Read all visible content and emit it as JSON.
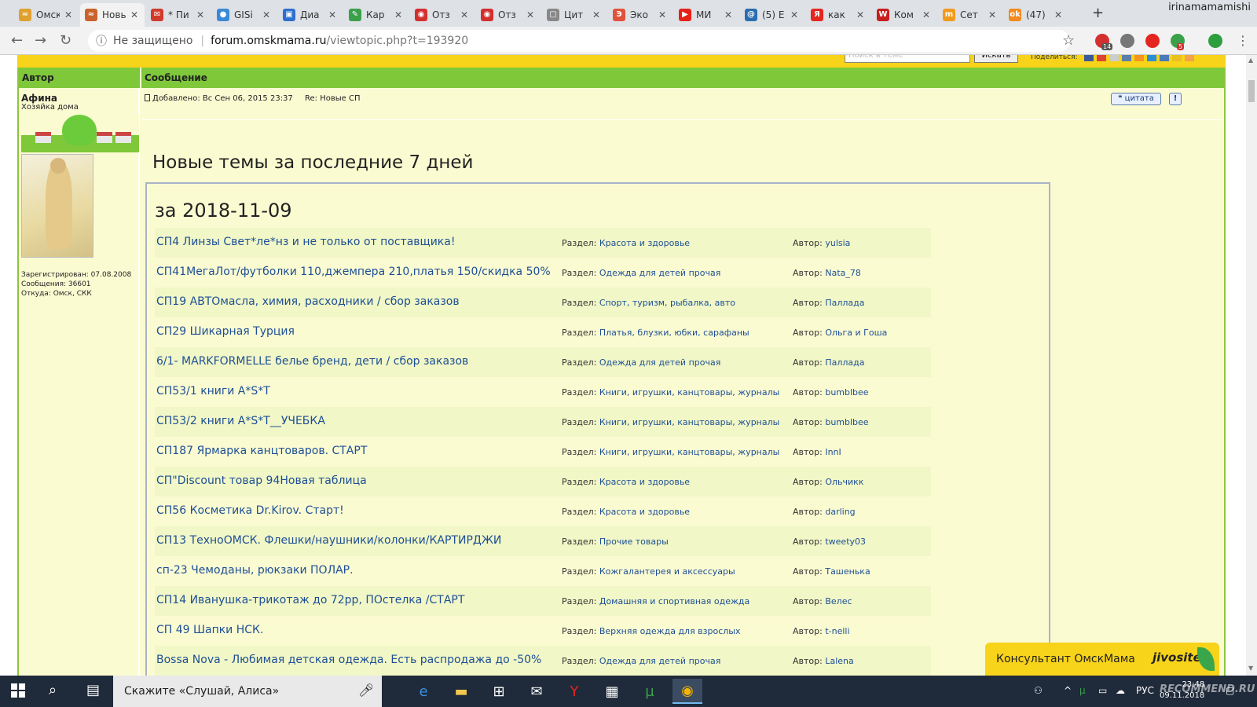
{
  "browser": {
    "tabs": [
      {
        "label": "Омск",
        "color": "#e0a030",
        "glyph": "≈"
      },
      {
        "label": "Новые",
        "color": "#c9622c",
        "glyph": "≈",
        "active": true
      },
      {
        "label": "* Пи",
        "color": "#d13b2b",
        "glyph": "✉"
      },
      {
        "label": "GISi",
        "color": "#3a8ad8",
        "glyph": "●"
      },
      {
        "label": "Диа",
        "color": "#2f6fd0",
        "glyph": "▣"
      },
      {
        "label": "Кар",
        "color": "#3aa04a",
        "glyph": "✎"
      },
      {
        "label": "Отз",
        "color": "#d32f2f",
        "glyph": "◉"
      },
      {
        "label": "Отз",
        "color": "#d32f2f",
        "glyph": "◉"
      },
      {
        "label": "Цит",
        "color": "#888888",
        "glyph": "▢"
      },
      {
        "label": "Эко",
        "color": "#e0533a",
        "glyph": "Э"
      },
      {
        "label": "МИ",
        "color": "#e62117",
        "glyph": "▶"
      },
      {
        "label": "(5) Е",
        "color": "#2a6db0",
        "glyph": "@"
      },
      {
        "label": "как",
        "color": "#e52620",
        "glyph": "Я"
      },
      {
        "label": "Ком",
        "color": "#c81e1e",
        "glyph": "W"
      },
      {
        "label": "Сет",
        "color": "#f29a1d",
        "glyph": "m"
      },
      {
        "label": "(47)",
        "color": "#f28a1d",
        "glyph": "ok"
      }
    ],
    "close_glyph": "✕",
    "new_tab_glyph": "+",
    "profile_name": "irinamamamishi",
    "security_label": "Не защищено",
    "url_domain": "forum.omskmama.ru",
    "url_path": "/viewtopic.php?t=193920",
    "extensions": [
      {
        "color": "#d32f2f",
        "badge": "14"
      },
      {
        "color": "#777777",
        "badge": ""
      },
      {
        "color": "#e52620",
        "badge": ""
      },
      {
        "color": "#3aa04a",
        "badge": "5"
      },
      {
        "color": "#2e9e3e",
        "badge": ""
      }
    ]
  },
  "forum": {
    "search_placeholder": "Поиск в теме",
    "search_button": "Искать",
    "share_label": "Поделиться:",
    "header_author": "Автор",
    "header_message": "Сообщение",
    "author": {
      "name": "Афина",
      "rank": "Хозяйка дома",
      "registered": "Зарегистрирован: 07.08.2008",
      "posts": "Сообщения: 36601",
      "location": "Откуда: Омск, СКК"
    },
    "post": {
      "added": "Добавлено: Вс Сен 06, 2015 23:37",
      "subject": "Re: Новые СП",
      "quote_label": "цитата",
      "report_label": "!"
    },
    "title": "Новые темы за последние 7 дней",
    "date_heading": "за 2018-11-09",
    "section_prefix": "Раздел:",
    "author_prefix": "Автор:",
    "topics": [
      {
        "title": "СП4 Линзы Свет*ле*нз и не только от поставщика!",
        "section": "Красота и здоровье",
        "author": "yulsia"
      },
      {
        "title": "СП41МегаЛот/футболки 110,джемпера 210,платья 150/скидка 50%",
        "section": "Одежда для детей прочая",
        "author": "Nata_78"
      },
      {
        "title": "СП19 АВТОмасла, химия, расходники / сбор заказов",
        "section": "Спорт, туризм, рыбалка, авто",
        "author": "Паллада"
      },
      {
        "title": "СП29 Шикарная Турция",
        "section": "Платья, блузки, юбки, сарафаны",
        "author": "Ольга и Гоша"
      },
      {
        "title": "6/1- MARKFORMELLE белье бренд, дети / сбор заказов",
        "section": "Одежда для детей прочая",
        "author": "Паллада"
      },
      {
        "title": "СП53/1 книги А*S*T",
        "section": "Книги, игрушки, канцтовары, журналы",
        "author": "bumblbee"
      },
      {
        "title": "СП53/2 книги А*S*T__УЧЕБКА",
        "section": "Книги, игрушки, канцтовары, журналы",
        "author": "bumblbee"
      },
      {
        "title": "СП187 Ярмарка канцтоваров. СТАРТ",
        "section": "Книги, игрушки, канцтовары, журналы",
        "author": "InnI"
      },
      {
        "title": "СП\"Discount товар 94Новая таблица",
        "section": "Красота и здоровье",
        "author": "Ольчикк"
      },
      {
        "title": "СП56 Косметика Dr.Kirov. Старт!",
        "section": "Красота и здоровье",
        "author": "darling"
      },
      {
        "title": "СП13 ТехноОМСК. Флешки/наушники/колонки/КАРТИРДЖИ",
        "section": "Прочие товары",
        "author": "tweety03"
      },
      {
        "title": "сп-23 Чемоданы, рюкзаки ПОЛАР.",
        "section": "Кожгалантерея и аксессуары",
        "author": "Ташенька"
      },
      {
        "title": "СП14 Иванушка-трикотаж до 72рр, ПОстелка /СТАРТ",
        "section": "Домашняя и спортивная одежда",
        "author": "Велес"
      },
      {
        "title": "СП 49 Шапки НСК.",
        "section": "Верхняя одежда для взрослых",
        "author": "t-nelli"
      },
      {
        "title": "Bossa Nova - Любимая детская одежда. Есть распродажа до -50%",
        "section": "Одежда для детей прочая",
        "author": "Lalena"
      }
    ],
    "chat_label": "Консультант ОмскМама",
    "chat_brand": "jivosite"
  },
  "taskbar": {
    "search_text": "Скажите «Слушай, Алиса»",
    "clock_time": "23:48",
    "clock_date": "09.11.2018",
    "lang": "РУС",
    "watermark": "RECOMMEND.RU"
  }
}
